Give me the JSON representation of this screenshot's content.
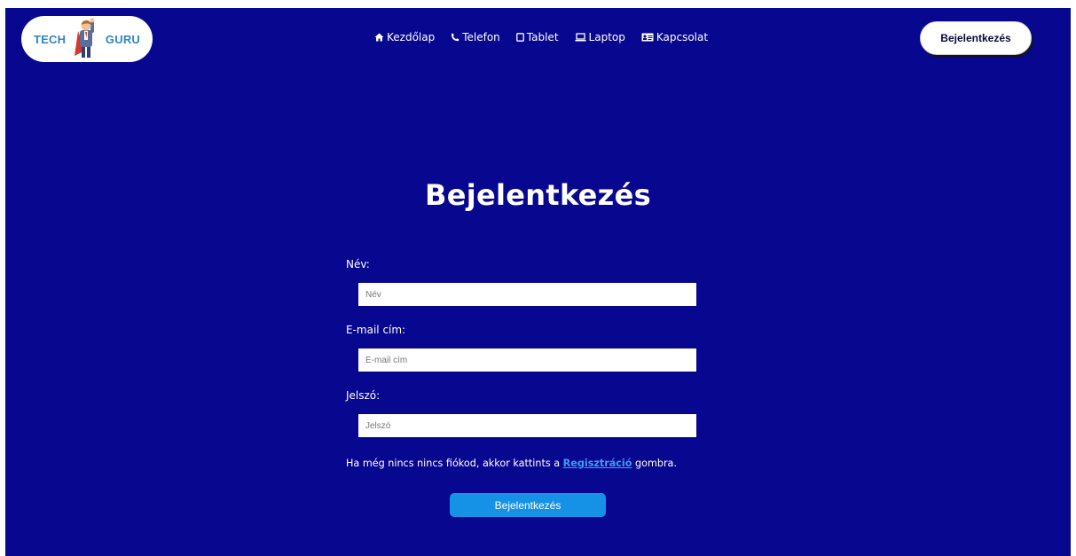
{
  "header": {
    "logo": {
      "left_text": "TECH",
      "right_text": "GURU",
      "icon": "superhero-icon"
    },
    "nav": [
      {
        "label": "Kezdőlap",
        "icon": "home-icon"
      },
      {
        "label": "Telefon",
        "icon": "phone-icon"
      },
      {
        "label": "Tablet",
        "icon": "tablet-icon"
      },
      {
        "label": "Laptop",
        "icon": "laptop-icon"
      },
      {
        "label": "Kapcsolat",
        "icon": "contact-card-icon"
      }
    ],
    "login_button": "Bejelentkezés"
  },
  "main": {
    "title": "Bejelentkezés",
    "form": {
      "name_label": "Név:",
      "name_placeholder": "Név",
      "email_label": "E-mail cím:",
      "email_placeholder": "E-mail cím",
      "password_label": "Jelszó:",
      "password_placeholder": "Jelszó",
      "help_prefix": "Ha még nincs nincs fiókod, akkor kattints a ",
      "help_link": "Regisztráció",
      "help_suffix": " gombra.",
      "submit_label": "Bejelentkezés"
    }
  },
  "colors": {
    "background": "#08078f",
    "accent_button": "#1592e6",
    "link": "#3ba0f5",
    "logo_text": "#2f86c8"
  }
}
